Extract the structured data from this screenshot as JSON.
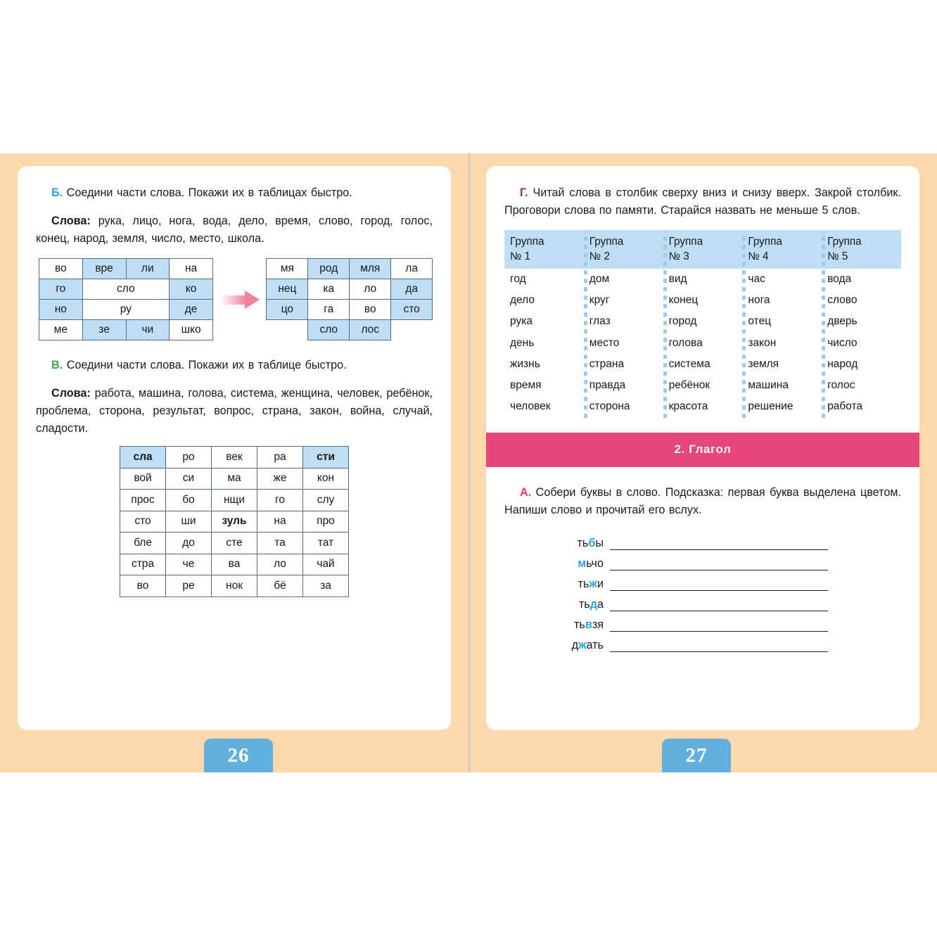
{
  "left_page": {
    "number": "26",
    "exercise_b": {
      "marker": "Б.",
      "instruction": "Соедини части слова. Покажи их в таблицах быстро.",
      "words_label": "Слова:",
      "words": "рука, лицо, нога, вода, дело, время, слово, город, голос, конец, народ, земля, число, место, школа.",
      "table_left": [
        [
          {
            "t": "во",
            "blue": false,
            "span": 1
          },
          {
            "t": "вре",
            "blue": true,
            "span": 1
          },
          {
            "t": "ли",
            "blue": true,
            "span": 1
          },
          {
            "t": "на",
            "blue": false,
            "span": 1
          }
        ],
        [
          {
            "t": "го",
            "blue": true,
            "span": 1
          },
          {
            "t": "сло",
            "blue": false,
            "span": 2
          },
          {
            "t": "ко",
            "blue": true,
            "span": 1
          }
        ],
        [
          {
            "t": "но",
            "blue": true,
            "span": 1
          },
          {
            "t": "ру",
            "blue": false,
            "span": 2
          },
          {
            "t": "де",
            "blue": true,
            "span": 1
          }
        ],
        [
          {
            "t": "ме",
            "blue": false,
            "span": 1
          },
          {
            "t": "зе",
            "blue": true,
            "span": 1
          },
          {
            "t": "чи",
            "blue": true,
            "span": 1
          },
          {
            "t": "шко",
            "blue": false,
            "span": 1
          }
        ]
      ],
      "table_right": [
        [
          {
            "t": "мя",
            "blue": false
          },
          {
            "t": "род",
            "blue": true
          },
          {
            "t": "мля",
            "blue": true
          },
          {
            "t": "ла",
            "blue": false
          }
        ],
        [
          {
            "t": "нец",
            "blue": true
          },
          {
            "t": "ка",
            "blue": false
          },
          {
            "t": "ло",
            "blue": false
          },
          {
            "t": "да",
            "blue": true
          }
        ],
        [
          {
            "t": "цо",
            "blue": true
          },
          {
            "t": "га",
            "blue": false
          },
          {
            "t": "во",
            "blue": false
          },
          {
            "t": "сто",
            "blue": true
          }
        ],
        [
          {
            "t": "",
            "empty": true
          },
          {
            "t": "сло",
            "blue": true
          },
          {
            "t": "лос",
            "blue": true
          },
          {
            "t": "",
            "empty": true
          }
        ]
      ],
      "arrow_icon": "arrow-right-icon"
    },
    "exercise_v": {
      "marker": "В.",
      "instruction": "Соедини части слова. Покажи их в таблице быстро.",
      "words_label": "Слова:",
      "words": "работа, машина, голова, система, женщина, человек, ребёнок, проблема, сторона, результат, вопрос, страна, закон, война, случай, сладости.",
      "grid": [
        [
          {
            "t": "сла",
            "blue": true,
            "bold": true
          },
          {
            "t": "ро"
          },
          {
            "t": "век"
          },
          {
            "t": "ра"
          },
          {
            "t": "сти",
            "blue": true,
            "bold": true
          }
        ],
        [
          {
            "t": "вой"
          },
          {
            "t": "си"
          },
          {
            "t": "ма"
          },
          {
            "t": "же"
          },
          {
            "t": "кон"
          }
        ],
        [
          {
            "t": "прос"
          },
          {
            "t": "бо"
          },
          {
            "t": "нщи"
          },
          {
            "t": "го"
          },
          {
            "t": "слу"
          }
        ],
        [
          {
            "t": "сто"
          },
          {
            "t": "ши"
          },
          {
            "t": "зуль",
            "bold": true
          },
          {
            "t": "на"
          },
          {
            "t": "про"
          }
        ],
        [
          {
            "t": "бле"
          },
          {
            "t": "до"
          },
          {
            "t": "сте"
          },
          {
            "t": "та"
          },
          {
            "t": "тат"
          }
        ],
        [
          {
            "t": "стра"
          },
          {
            "t": "че"
          },
          {
            "t": "ва"
          },
          {
            "t": "ло"
          },
          {
            "t": "чай"
          }
        ],
        [
          {
            "t": "во"
          },
          {
            "t": "ре"
          },
          {
            "t": "нок"
          },
          {
            "t": "бё"
          },
          {
            "t": "за"
          }
        ]
      ]
    }
  },
  "right_page": {
    "number": "27",
    "exercise_g": {
      "marker": "Г.",
      "instruction": "Читай слова в столбик сверху вниз и снизу вверх. Закрой столбик. Проговори слова по памяти. Старайся назвать не меньше 5 слов.",
      "columns": [
        {
          "header": "Группа № 1",
          "header_line1": "Группа",
          "header_line2": "№ 1",
          "words": [
            "год",
            "дело",
            "рука",
            "день",
            "жизнь",
            "время",
            "человек"
          ]
        },
        {
          "header": "Группа № 2",
          "header_line1": "Группа",
          "header_line2": "№ 2",
          "words": [
            "дом",
            "круг",
            "глаз",
            "место",
            "страна",
            "правда",
            "сторона"
          ]
        },
        {
          "header": "Группа № 3",
          "header_line1": "Группа",
          "header_line2": "№ 3",
          "words": [
            "вид",
            "конец",
            "город",
            "голова",
            "система",
            "ребёнок",
            "красота"
          ]
        },
        {
          "header": "Группа № 4",
          "header_line1": "Группа",
          "header_line2": "№ 4",
          "words": [
            "час",
            "нога",
            "отец",
            "закон",
            "земля",
            "машина",
            "решение"
          ]
        },
        {
          "header": "Группа № 5",
          "header_line1": "Группа",
          "header_line2": "№ 5",
          "words": [
            "вода",
            "слово",
            "дверь",
            "число",
            "народ",
            "голос",
            "работа"
          ]
        }
      ]
    },
    "section_banner": "2.  Глагол",
    "exercise_a": {
      "marker": "А.",
      "instruction": "Собери буквы в слово. Подсказка: первая буква выделена цветом. Напиши слово и прочитай его вслух.",
      "items": [
        {
          "pre": "ть",
          "hl": "б",
          "post": "ы"
        },
        {
          "pre": "",
          "hl": "м",
          "post": "ьчо"
        },
        {
          "pre": "ть",
          "hl": "ж",
          "post": "и"
        },
        {
          "pre": "ть",
          "hl": "д",
          "post": "а"
        },
        {
          "pre": "ть",
          "hl": "в",
          "post": "зя"
        },
        {
          "pre": "д",
          "hl": "ж",
          "post": "ать"
        }
      ]
    }
  },
  "colors": {
    "page_bg": "#fbd9ac",
    "cell_blue": "#bfdef3",
    "banner_pink": "#e8467a",
    "tab_blue": "#62b0dd",
    "highlight_blue": "#29a3e0",
    "arrow_pink": "#f2829e"
  }
}
